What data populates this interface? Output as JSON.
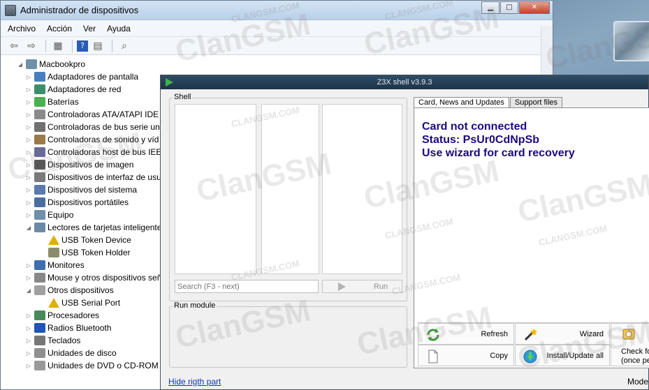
{
  "device_manager": {
    "title": "Administrador de dispositivos",
    "menu": [
      "Archivo",
      "Acción",
      "Ver",
      "Ayuda"
    ],
    "tree": [
      {
        "label": "Macbookpro",
        "level": 0,
        "expanded": true,
        "icon": "computer-icon"
      },
      {
        "label": "Adaptadores de pantalla",
        "level": 1,
        "icon": "display-adapter-icon"
      },
      {
        "label": "Adaptadores de red",
        "level": 1,
        "icon": "network-adapter-icon"
      },
      {
        "label": "Baterías",
        "level": 1,
        "icon": "battery-icon"
      },
      {
        "label": "Controladoras ATA/ATAPI IDE",
        "level": 1,
        "icon": "ide-controller-icon"
      },
      {
        "label": "Controladoras de bus serie un",
        "level": 1,
        "icon": "usb-controller-icon"
      },
      {
        "label": "Controladoras de sonido y víd",
        "level": 1,
        "icon": "sound-icon"
      },
      {
        "label": "Controladoras host de bus IEE",
        "level": 1,
        "icon": "firewire-icon"
      },
      {
        "label": "Dispositivos de imagen",
        "level": 1,
        "icon": "camera-icon"
      },
      {
        "label": "Dispositivos de interfaz de usu",
        "level": 1,
        "icon": "hid-icon"
      },
      {
        "label": "Dispositivos del sistema",
        "level": 1,
        "icon": "system-device-icon"
      },
      {
        "label": "Dispositivos portátiles",
        "level": 1,
        "icon": "portable-device-icon"
      },
      {
        "label": "Equipo",
        "level": 1,
        "icon": "computer-icon"
      },
      {
        "label": "Lectores de tarjetas inteligente",
        "level": 1,
        "expanded": true,
        "icon": "smartcard-reader-icon"
      },
      {
        "label": "USB Token Device",
        "level": 2,
        "icon": "warning-device-icon"
      },
      {
        "label": "USB Token Holder",
        "level": 2,
        "icon": "smartcard-icon"
      },
      {
        "label": "Monitores",
        "level": 1,
        "icon": "monitor-icon"
      },
      {
        "label": "Mouse y otros dispositivos señ",
        "level": 1,
        "icon": "mouse-icon"
      },
      {
        "label": "Otros dispositivos",
        "level": 1,
        "expanded": true,
        "icon": "unknown-device-icon"
      },
      {
        "label": "USB Serial Port",
        "level": 2,
        "icon": "warning-device-icon"
      },
      {
        "label": "Procesadores",
        "level": 1,
        "icon": "processor-icon"
      },
      {
        "label": "Radios Bluetooth",
        "level": 1,
        "icon": "bluetooth-icon"
      },
      {
        "label": "Teclados",
        "level": 1,
        "icon": "keyboard-icon"
      },
      {
        "label": "Unidades de disco",
        "level": 1,
        "icon": "disk-drive-icon"
      },
      {
        "label": "Unidades de DVD o CD-ROM",
        "level": 1,
        "icon": "dvd-drive-icon"
      }
    ]
  },
  "z3x": {
    "title": "Z3X shell v3.9.3",
    "shell_label": "Shell",
    "search_placeholder": "Search (F3 - next)",
    "run_label": "Run",
    "run_module_label": "Run module",
    "hide_link": "Hide rigth part",
    "mode_text": "Mode",
    "tabs": [
      {
        "label": "Card, News and Updates",
        "active": true
      },
      {
        "label": "Support files",
        "active": false
      }
    ],
    "info_lines": [
      "Card not connected",
      "Status: PsUr0CdNpSb",
      "Use wizard for card recovery"
    ],
    "actions": {
      "refresh": "Refresh",
      "wizard": "Wizard",
      "copy": "Copy",
      "install": "Install/Update all",
      "check_line1": "Check fo",
      "check_line2": "(once pe"
    }
  },
  "watermark": {
    "big": "ClanGSM",
    "small": "CLANGSM.COM"
  },
  "colors": {
    "info_text": "#1c0a7e",
    "link": "#0b39b5",
    "z3x_titlebar": "#1d3347"
  }
}
